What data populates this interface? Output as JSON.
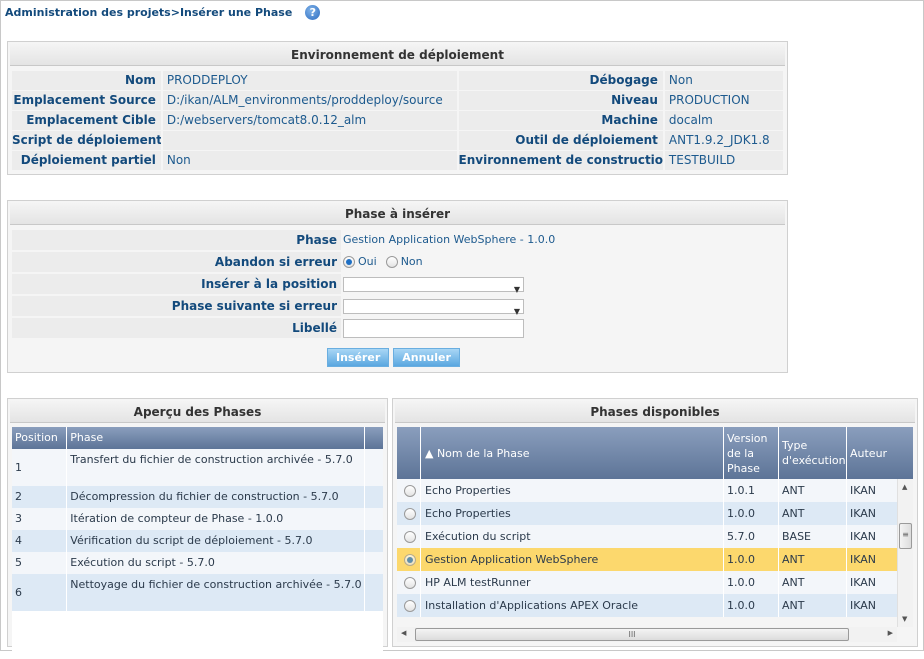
{
  "breadcrumb": "Administration des projets>Insérer une Phase",
  "help_icon": "help-icon",
  "environment": {
    "title": "Environnement de déploiement",
    "rows": [
      {
        "l1": "Nom",
        "v1": "PRODDEPLOY",
        "l2": "Débogage",
        "v2": "Non"
      },
      {
        "l1": "Emplacement Source",
        "v1": "D:/ikan/ALM_environments/proddeploy/source",
        "l2": "Niveau",
        "v2": "PRODUCTION"
      },
      {
        "l1": "Emplacement Cible",
        "v1": "D:/webservers/tomcat8.0.12_alm",
        "l2": "Machine",
        "v2": "docalm"
      },
      {
        "l1": "Script de déploiement",
        "v1": "",
        "l2": "Outil de déploiement",
        "v2": "ANT1.9.2_JDK1.8"
      },
      {
        "l1": "Déploiement partiel",
        "v1": "Non",
        "l2": "Environnement de construction",
        "v2": "TESTBUILD"
      }
    ]
  },
  "insert": {
    "title": "Phase à insérer",
    "phase_label": "Phase",
    "phase_value": "Gestion Application WebSphere - 1.0.0",
    "abort_label": "Abandon si erreur",
    "abort_options": [
      "Oui",
      "Non"
    ],
    "abort_selected": "Oui",
    "position_label": "Insérer à la position",
    "position_value": "",
    "next_label": "Phase suivante si erreur",
    "next_value": "",
    "label_label": "Libellé",
    "label_value": "",
    "insert_button": "Insérer",
    "cancel_button": "Annuler"
  },
  "overview": {
    "title": "Aperçu des Phases",
    "columns": [
      "Position",
      "Phase"
    ],
    "rows": [
      {
        "pos": "1",
        "phase": "Transfert du fichier de construction archivée - 5.7.0"
      },
      {
        "pos": "2",
        "phase": "Décompression du fichier de construction - 5.7.0"
      },
      {
        "pos": "3",
        "phase": "Itération de compteur de Phase - 1.0.0"
      },
      {
        "pos": "4",
        "phase": "Vérification du script de déploiement - 5.7.0"
      },
      {
        "pos": "5",
        "phase": "Exécution du script - 5.7.0"
      },
      {
        "pos": "6",
        "phase": "Nettoyage du fichier de construction archivée - 5.7.0"
      }
    ]
  },
  "available": {
    "title": "Phases disponibles",
    "columns": [
      "▲ Nom de la Phase",
      "Version de la Phase",
      "Type d'exécution",
      "Auteur"
    ],
    "rows": [
      {
        "name": "Echo Properties",
        "version": "1.0.1",
        "type": "ANT",
        "author": "IKAN",
        "selected": false
      },
      {
        "name": "Echo Properties",
        "version": "1.0.0",
        "type": "ANT",
        "author": "IKAN",
        "selected": false
      },
      {
        "name": "Exécution du script",
        "version": "5.7.0",
        "type": "BASE",
        "author": "IKAN",
        "selected": false
      },
      {
        "name": "Gestion Application WebSphere",
        "version": "1.0.0",
        "type": "ANT",
        "author": "IKAN",
        "selected": true
      },
      {
        "name": "HP ALM testRunner",
        "version": "1.0.0",
        "type": "ANT",
        "author": "IKAN",
        "selected": false
      },
      {
        "name": "Installation d'Applications APEX Oracle",
        "version": "1.0.0",
        "type": "ANT",
        "author": "IKAN",
        "selected": false
      }
    ]
  },
  "colors": {
    "selected_row": "#fcd86d",
    "header_bg": "#6b82a5",
    "button_bg": "#5aa7e0",
    "label_text": "#134a7c"
  }
}
